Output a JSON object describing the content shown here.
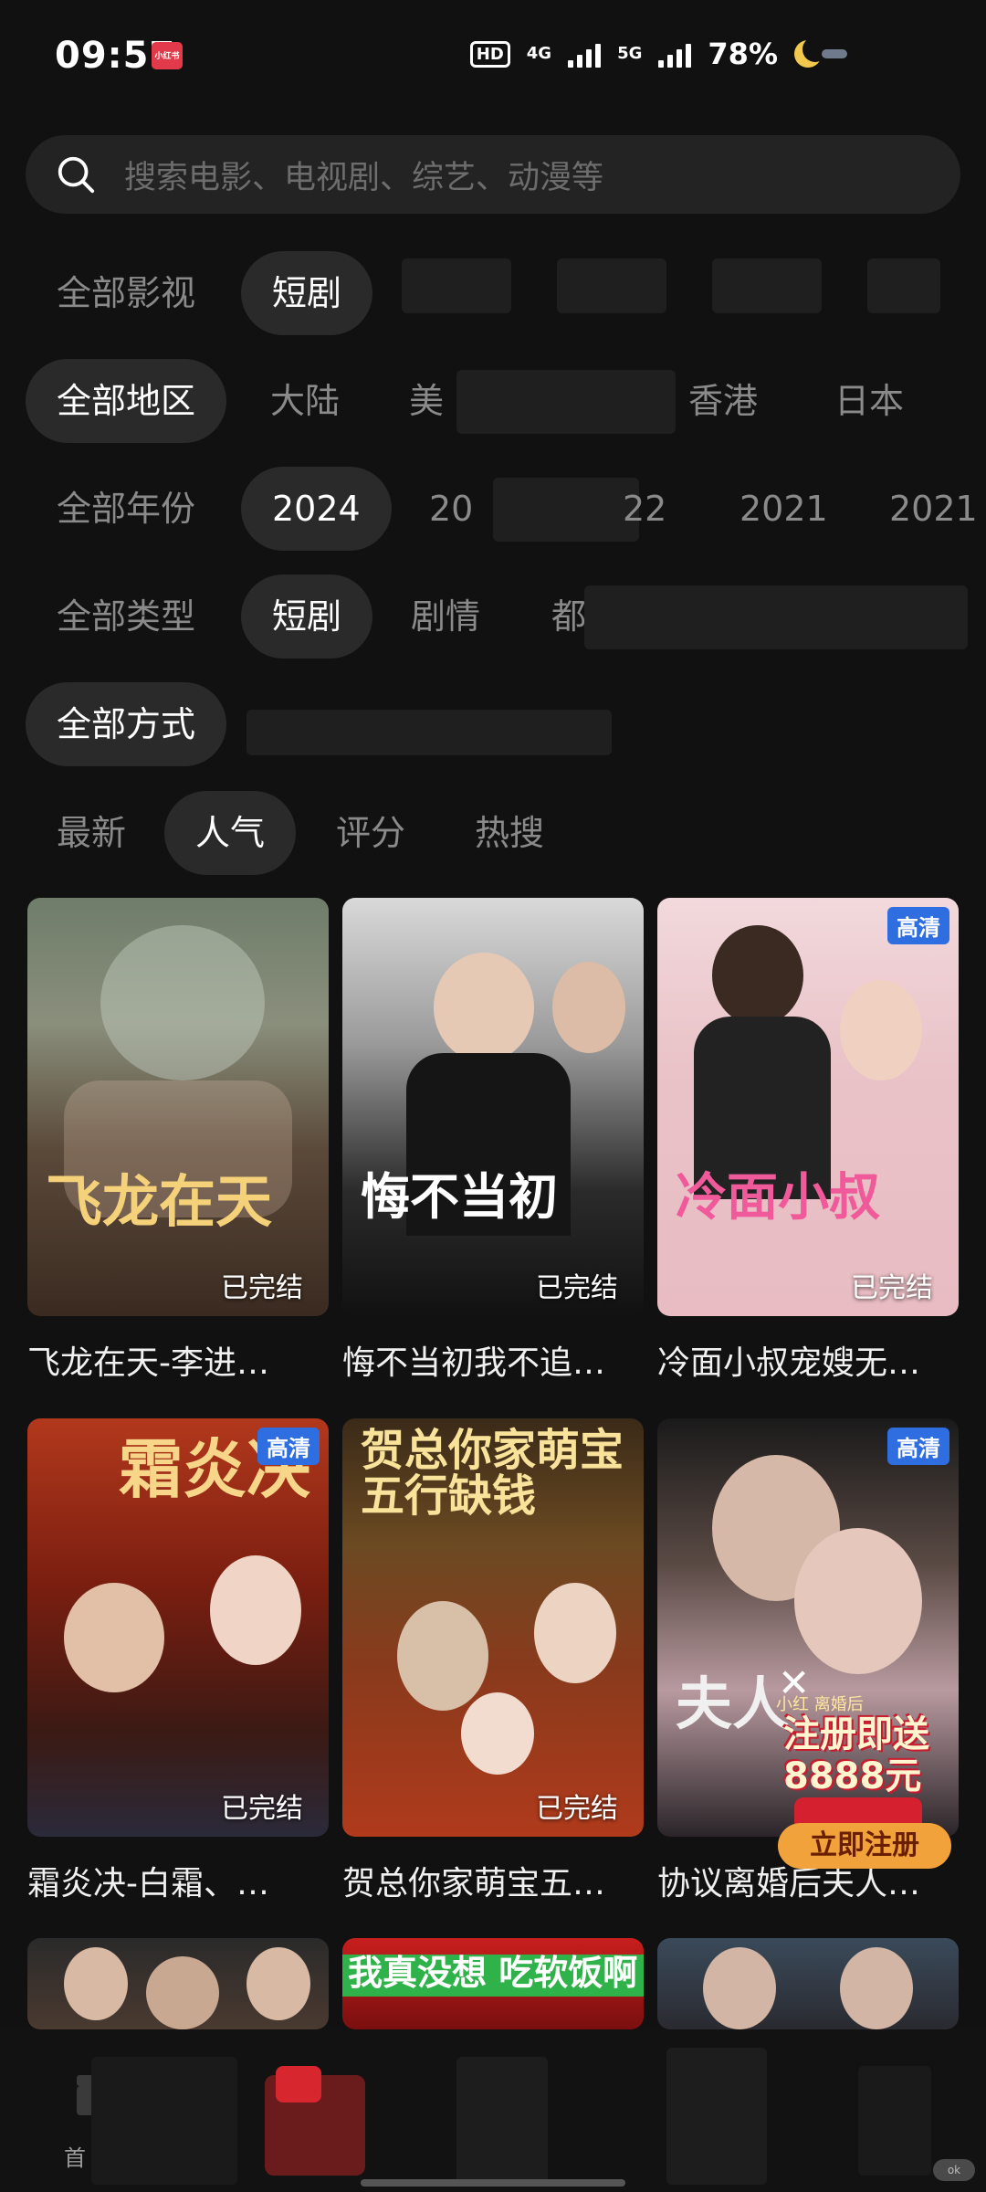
{
  "status": {
    "time": "09:57",
    "rec_badge": "小红书",
    "battery": "78%",
    "net1": "4G",
    "net2": "5G",
    "hd": "HD"
  },
  "search": {
    "placeholder": "搜索电影、电视剧、综艺、动漫等"
  },
  "filters": {
    "row1": {
      "label": "全部影视",
      "selected": "短剧"
    },
    "row2": {
      "label": "全部地区",
      "items": [
        "大陆",
        "美",
        "香港",
        "日本"
      ]
    },
    "row3": {
      "label": "全部年份",
      "selected": "2024",
      "items": [
        "20",
        "22",
        "2021",
        "2021"
      ]
    },
    "row4": {
      "label": "全部类型",
      "selected": "短剧",
      "items": [
        "剧情",
        "都市"
      ]
    },
    "row5": {
      "label": "全部方式"
    }
  },
  "sort": {
    "items": [
      "最新",
      "人气",
      "评分",
      "热搜"
    ],
    "selected": "人气"
  },
  "cards": [
    {
      "title": "飞龙在天-李进…",
      "status": "已完结",
      "poster_text": "飞龙在天"
    },
    {
      "title": "悔不当初我不追…",
      "status": "已完结",
      "poster_text": "悔不当初"
    },
    {
      "title": "冷面小叔宠嫂无…",
      "status": "已完结",
      "poster_text": "冷面小叔",
      "badge": "高清"
    },
    {
      "title": "霜炎决-白霜、…",
      "status": "已完结",
      "poster_text": "霜炎决",
      "badge": "高清"
    },
    {
      "title": "贺总你家萌宝五…",
      "status": "已完结",
      "poster_text": "贺总你家萌宝 五行缺钱"
    },
    {
      "title": "协议离婚后夫人…",
      "poster_text": "夫人",
      "badge": "高清"
    }
  ],
  "third_row_posters": [
    "",
    "我真没想 吃软饭啊",
    ""
  ],
  "ad": {
    "top": "小红 离婚后",
    "money": "注册即送 8888元",
    "button": "立即注册"
  },
  "tabbar": {
    "home_label": "首"
  },
  "corner_badge": "ok"
}
